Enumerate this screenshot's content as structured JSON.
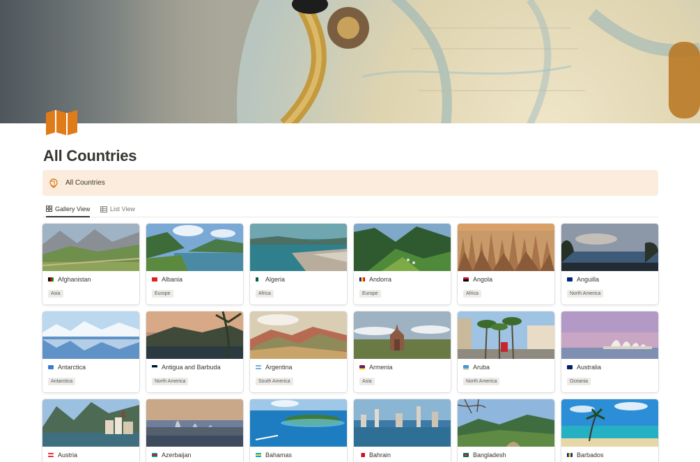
{
  "page": {
    "title": "All Countries",
    "callout_text": "All Countries",
    "callout_icon": "globe-icon",
    "page_icon": "map-icon",
    "cover": "vintage-globe-photo",
    "accent_color": "#e07b1a",
    "callout_bg": "#fbecdd"
  },
  "tabs": [
    {
      "label": "Gallery View",
      "icon": "gallery-icon",
      "active": true
    },
    {
      "label": "List View",
      "icon": "table-icon",
      "active": false
    }
  ],
  "cards": [
    {
      "name": "Afghanistan",
      "region": "Asia",
      "flag": [
        "#000000",
        "#be0000",
        "#009900"
      ]
    },
    {
      "name": "Albania",
      "region": "Europe",
      "flag": [
        "#e41e20",
        "#e41e20",
        "#e41e20"
      ]
    },
    {
      "name": "Algeria",
      "region": "Africa",
      "flag": [
        "#006233",
        "#ffffff",
        "#d21034"
      ]
    },
    {
      "name": "Andorra",
      "region": "Europe",
      "flag": [
        "#10069f",
        "#fedd00",
        "#d50032"
      ]
    },
    {
      "name": "Angola",
      "region": "Africa",
      "flag": [
        "#cc092f",
        "#000000",
        "#ffcb00"
      ]
    },
    {
      "name": "Anguilla",
      "region": "North America",
      "flag": [
        "#00247d",
        "#ffffff",
        "#cf142b"
      ]
    },
    {
      "name": "Antarctica",
      "region": "Antarctica",
      "flag": [
        "#3a7dce",
        "#ffffff",
        "#3a7dce"
      ]
    },
    {
      "name": "Antigua and Barbuda",
      "region": "North America",
      "flag": [
        "#ce1126",
        "#000000",
        "#0072c6"
      ]
    },
    {
      "name": "Argentina",
      "region": "South America",
      "flag": [
        "#74acdf",
        "#ffffff",
        "#74acdf"
      ]
    },
    {
      "name": "Armenia",
      "region": "Asia",
      "flag": [
        "#d90012",
        "#0033a0",
        "#f2a800"
      ]
    },
    {
      "name": "Aruba",
      "region": "North America",
      "flag": [
        "#418fde",
        "#fbe122",
        "#418fde"
      ]
    },
    {
      "name": "Australia",
      "region": "Oceania",
      "flag": [
        "#012169",
        "#ffffff",
        "#e4002b"
      ]
    },
    {
      "name": "Austria",
      "region": "",
      "flag": [
        "#ed2939",
        "#ffffff",
        "#ed2939"
      ]
    },
    {
      "name": "Azerbaijan",
      "region": "",
      "flag": [
        "#0092bc",
        "#e4002b",
        "#00af66"
      ]
    },
    {
      "name": "Bahamas",
      "region": "",
      "flag": [
        "#00abc9",
        "#fae042",
        "#00abc9"
      ]
    },
    {
      "name": "Bahrain",
      "region": "",
      "flag": [
        "#ce1126",
        "#ffffff",
        "#ce1126"
      ]
    },
    {
      "name": "Bangladesh",
      "region": "",
      "flag": [
        "#006a4e",
        "#f42a41",
        "#006a4e"
      ]
    },
    {
      "name": "Barbados",
      "region": "",
      "flag": [
        "#00267f",
        "#ffc726",
        "#00267f"
      ]
    }
  ]
}
